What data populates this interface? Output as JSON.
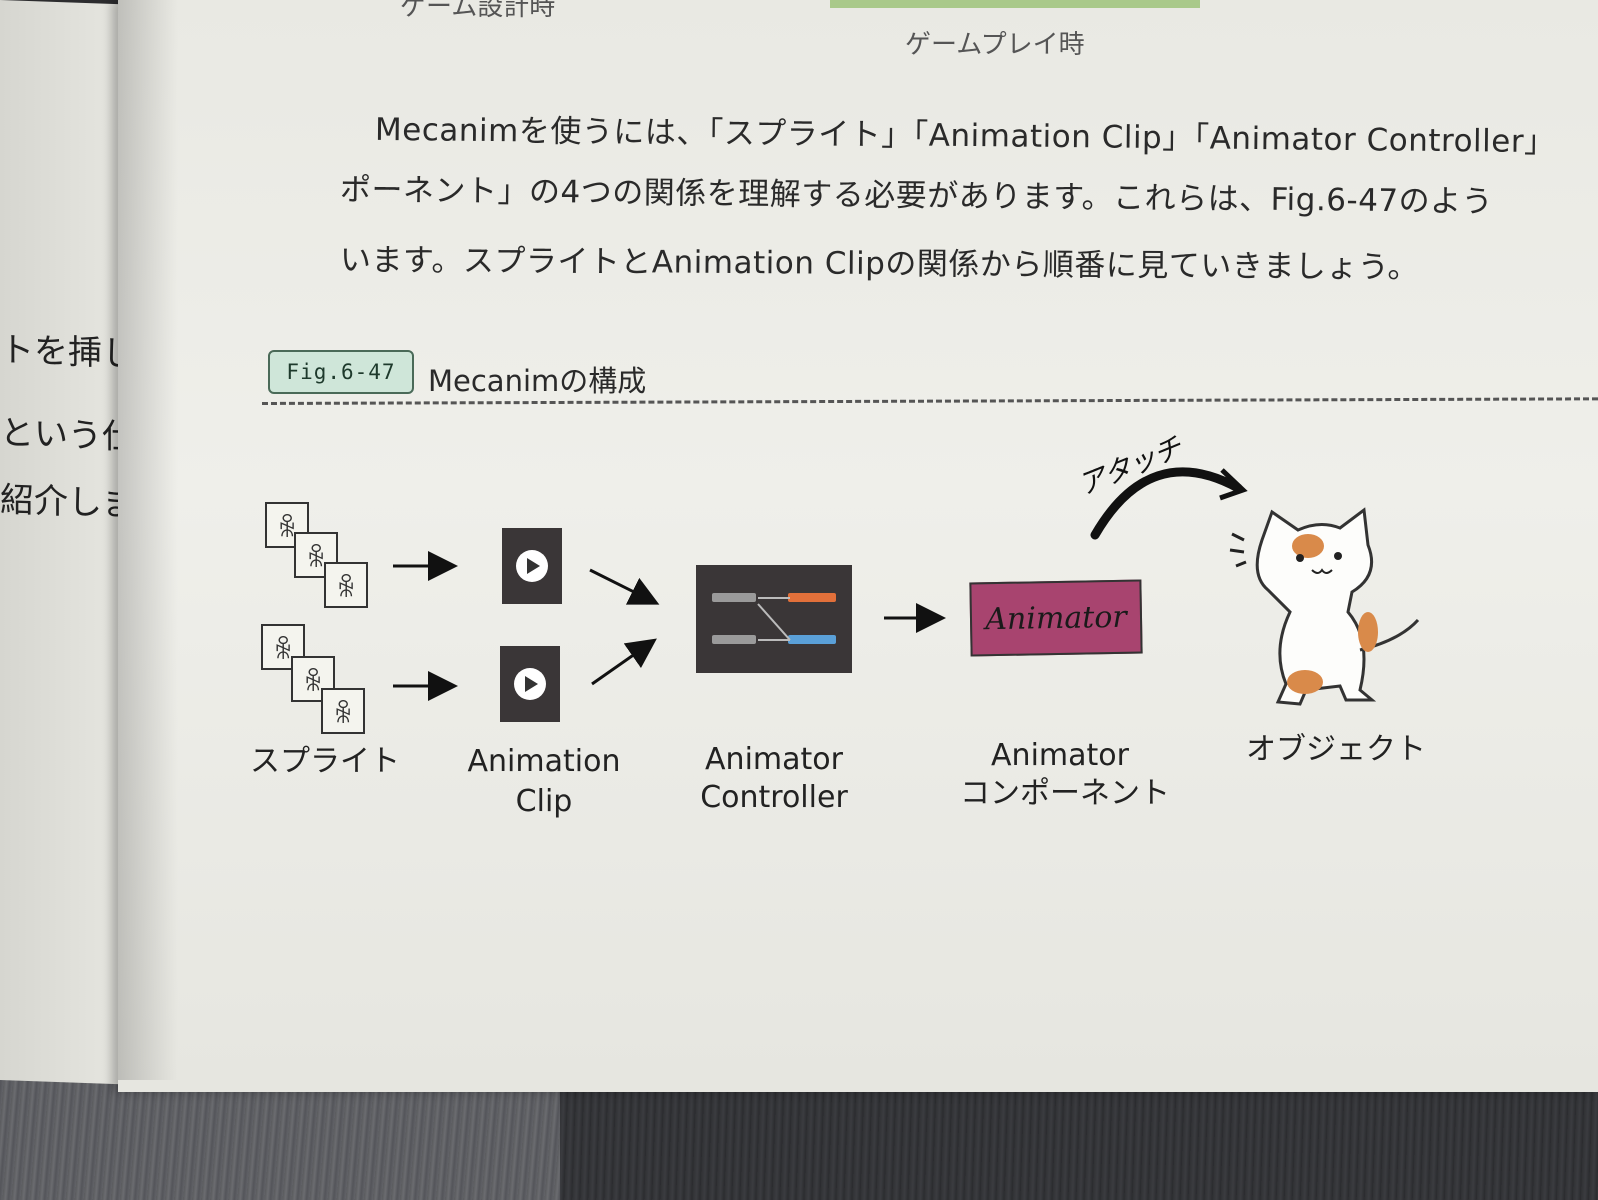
{
  "left_page": {
    "fragments": [
      "トを挿し",
      "という仕",
      "紹介しま"
    ]
  },
  "header": {
    "top_cut_text": "ゲーム設計時",
    "caption_right": "ゲームプレイ時"
  },
  "body": {
    "lines": [
      "Mecanimを使うには、「スプライト」「Animation Clip」「Animator Controller」",
      "ポーネント」の4つの関係を理解する必要があります。これらは、Fig.6-47のよう",
      "います。スプライトとAnimation Clipの関係から順番に見ていきましょう。"
    ]
  },
  "figure": {
    "tag": "Fig.6-47",
    "title": "Mecanimの構成",
    "labels": {
      "sprite": "スプライト",
      "clip_line1": "Animation",
      "clip_line2": "Clip",
      "controller_line1": "Animator",
      "controller_line2": "Controller",
      "component_line1": "Animator",
      "component_line2": "コンポーネント",
      "object": "オブジェクト"
    },
    "animator_box_text": "Animator",
    "attach_text": "アタッチ",
    "colors": {
      "animator_box": "#a8446f",
      "controller_bg": "#3a3637",
      "controller_orange": "#e2703a",
      "controller_blue": "#5aa0d8",
      "tag_bg": "#cfe6d9"
    }
  }
}
